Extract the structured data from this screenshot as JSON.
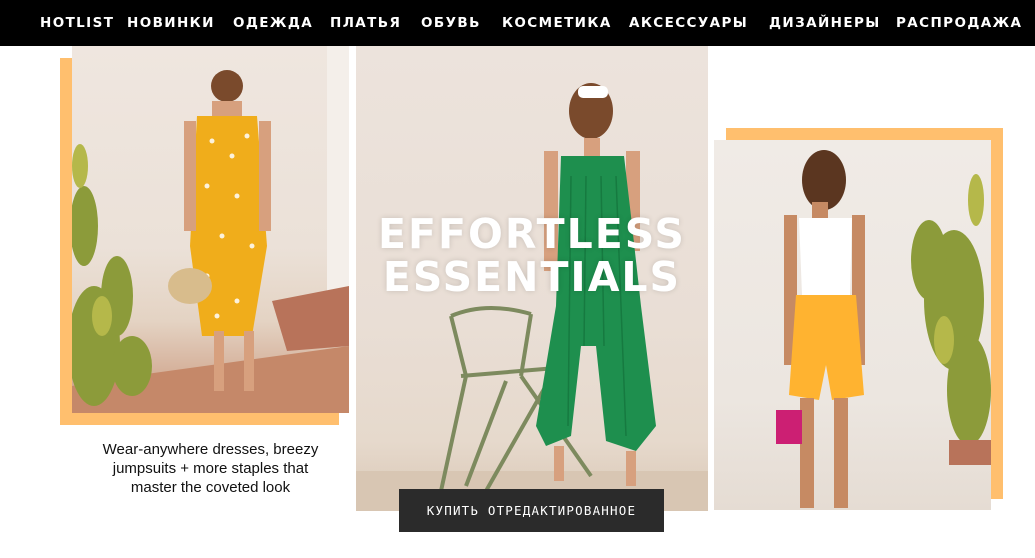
{
  "nav": {
    "items": [
      {
        "label": "HOTLIST"
      },
      {
        "label": "НОВИНКИ"
      },
      {
        "label": "ОДЕЖДА"
      },
      {
        "label": "ПЛАТЬЯ"
      },
      {
        "label": "ОБУВЬ"
      },
      {
        "label": "КОСМЕТИКА"
      },
      {
        "label": "АКСЕССУАРЫ"
      },
      {
        "label": "ДИЗАЙНЕРЫ"
      },
      {
        "label": "РАСПРОДАЖА"
      }
    ]
  },
  "hero": {
    "headline_line1": "EFFORTLESS",
    "headline_line2": "ESSENTIALS",
    "caption_line1": "Wear-anywhere dresses, breezy",
    "caption_line2": "jumpsuits + more staples that",
    "caption_line3": "master the coveted look",
    "cta_label": "КУПИТЬ ОТРЕДАКТИРОВАННОЕ"
  },
  "colors": {
    "nav_background": "#000000",
    "accent_frame": "#ffbf6e",
    "cta_background": "#2b2b2b"
  }
}
